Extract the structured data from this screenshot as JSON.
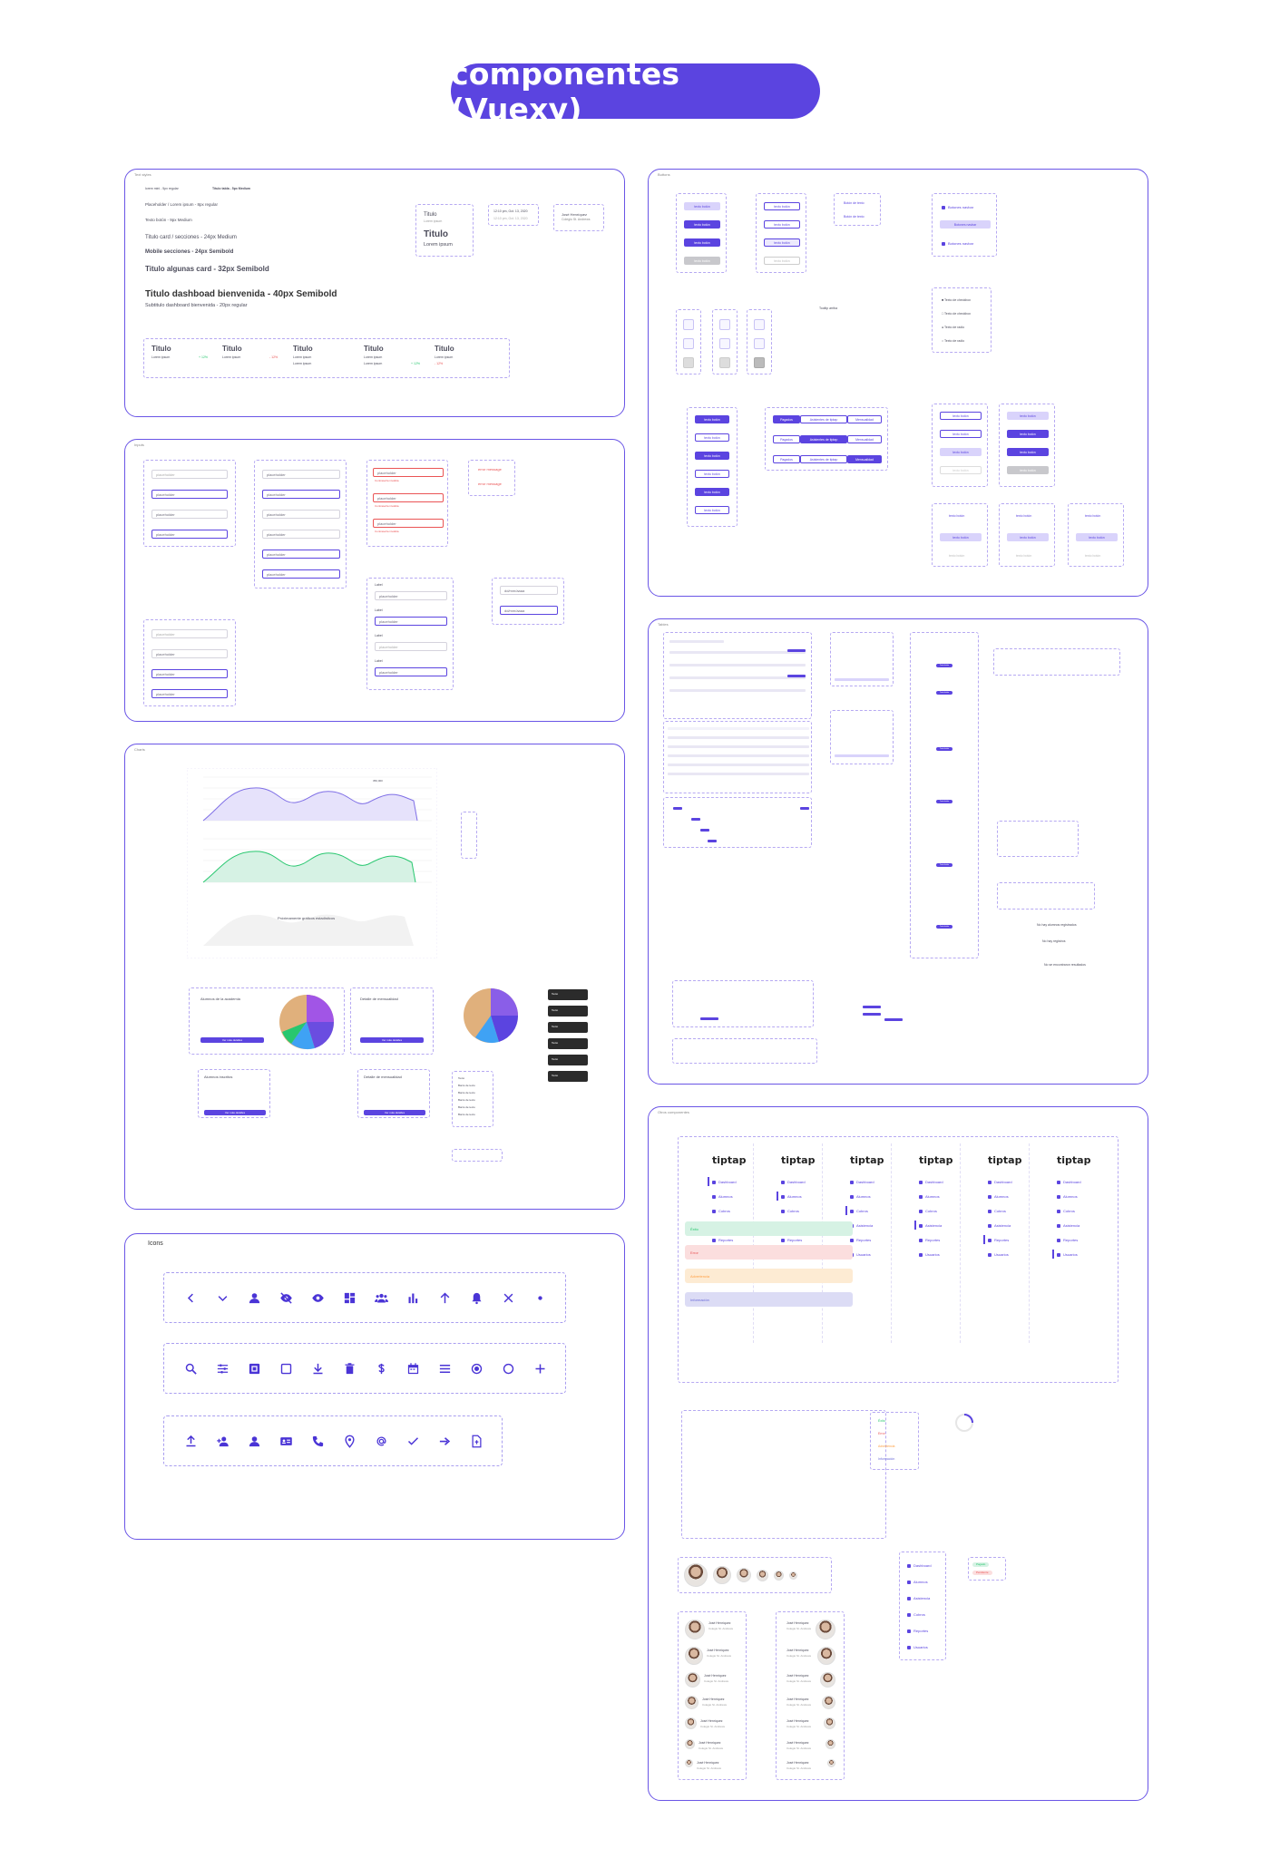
{
  "title": "componentes (Vuexy)",
  "frames": {
    "typography": "Text styles",
    "buttons": "Buttons",
    "inputs": "Inputs",
    "charts": "Charts",
    "icons": "Icons",
    "tables": "Tables",
    "general": "Otros componentes"
  },
  "typography": {
    "line1a": "lorem mini - 5px regular",
    "line1b": "Título tabla - 5px Medium",
    "line2": "Placeholder / Lorem ipsum - 8px regular",
    "line3": "Texto botón - 9px Medium",
    "line4": "Titulo card / secciones - 24px Medium",
    "line5": "Mobile secciones - 24px Semibold",
    "line6": "Titulo algunas card - 32px Semibold",
    "line7": "Titulo dashboad bienvenida - 40px Semibold",
    "line8": "Subtitulo dashboard bienvenida - 20px regular",
    "card_title": "Titulo",
    "card_sub": "Lorem ipsum",
    "card_big": "Titulo",
    "card_big_sub": "Lorem ipsum",
    "date1": "12:10 pm, Oct. 13, 2020",
    "date2": "12:10 pm, Oct. 13, 2020",
    "person_name": "José Henríquez",
    "person_role": "Colegio St. Andrews",
    "stats": [
      {
        "title": "Titulo",
        "sub": "Lorem ipsum",
        "delta": "+ 12%",
        "up": true
      },
      {
        "title": "Titulo",
        "sub": "Lorem ipsum",
        "delta": "- 12%",
        "up": false
      },
      {
        "title": "Titulo",
        "sub": "Lorem ipsum",
        "delta": "",
        "up": true
      },
      {
        "title": "Titulo",
        "sub": "Lorem ipsum",
        "delta": "+ 12%",
        "up": true
      },
      {
        "title": "Titulo",
        "sub": "Lorem ipsum",
        "delta": "- 12%",
        "up": false
      }
    ]
  },
  "buttons": {
    "label": "texto botón",
    "text_link": "Botón de texto",
    "sidebar_btn": "Botones navbar",
    "tooltip": "Tooltip arriba",
    "checks": [
      "Texto de checkbox",
      "Texto de checkbox",
      "Texto de radio",
      "Texto de radio"
    ],
    "segments": [
      "Pagados",
      "Asistentes de tiptap",
      "Mensualidad"
    ]
  },
  "inputs": {
    "placeholder": "placeholder",
    "error_msg": "Contraseña inválida",
    "error_text": "error message",
    "label": "Label",
    "date": "dd/mm/aaaa"
  },
  "charts": {
    "legend_value": "350,000",
    "dark_item": "Texto",
    "empty_text": "Próximamente gráficos estadísticos",
    "card1_title": "Alumnos de la academia",
    "card2_title": "Detalle de mensualidad",
    "card3_title": "Alumnos inscritos",
    "card4_title": "Detalle de mensualidad",
    "card_button": "Ver más detalles",
    "list_items": [
      "Texto",
      "Barra de texto",
      "Barra de texto",
      "Barra de texto",
      "Barra de texto",
      "Barra de texto"
    ]
  },
  "icons": {
    "title": "Icons",
    "row1": [
      "chevron-left-icon",
      "chevron-down-icon",
      "user-icon",
      "eye-off-icon",
      "eye-icon",
      "dashboard-icon",
      "users-icon",
      "bar-chart-icon",
      "arrow-up-icon",
      "bell-icon",
      "close-icon",
      "dot-icon"
    ],
    "row2": [
      "search-icon",
      "sliders-icon",
      "checkbox-checked-icon",
      "checkbox-empty-icon",
      "download-icon",
      "trash-icon",
      "dollar-icon",
      "calendar-icon",
      "menu-icon",
      "radio-checked-icon",
      "radio-empty-icon",
      "plus-icon"
    ],
    "row3": [
      "upload-icon",
      "user-plus-icon",
      "user-alt-icon",
      "id-card-icon",
      "phone-icon",
      "location-icon",
      "at-icon",
      "check-icon",
      "arrow-right-icon",
      "file-icon"
    ]
  },
  "tables": {
    "empty_title": "No hay alumnos registrados",
    "empty_sub": "No hay registros",
    "empty_sub2": "No se encontraron resultados",
    "button": "Texto botón"
  },
  "general": {
    "logo": "tiptap",
    "menu": [
      "Dashboard",
      "Alumnos",
      "Cobros",
      "Asistencia",
      "Reportes",
      "Usuarios"
    ],
    "alerts": [
      {
        "text": "Éxito",
        "bg": "#d6f2e4",
        "fg": "#28c76f"
      },
      {
        "text": "Error",
        "bg": "#fbdede",
        "fg": "#ea5455"
      },
      {
        "text": "Advertencia",
        "bg": "#fdebd3",
        "fg": "#ff9f43"
      },
      {
        "text": "Información",
        "bg": "#dcdcf5",
        "fg": "#6a6ad8"
      }
    ],
    "mini_alerts": [
      "Éxito",
      "Error",
      "Advertencia",
      "Información"
    ],
    "person_name": "José Henríquez",
    "person_role": "Colegio St. Andrews",
    "badges": [
      "Pagado",
      "Pendiente"
    ]
  },
  "colors": {
    "accent": "#5b44e0",
    "success": "#28c76f",
    "danger": "#ea5455",
    "warning": "#ff9f43"
  }
}
